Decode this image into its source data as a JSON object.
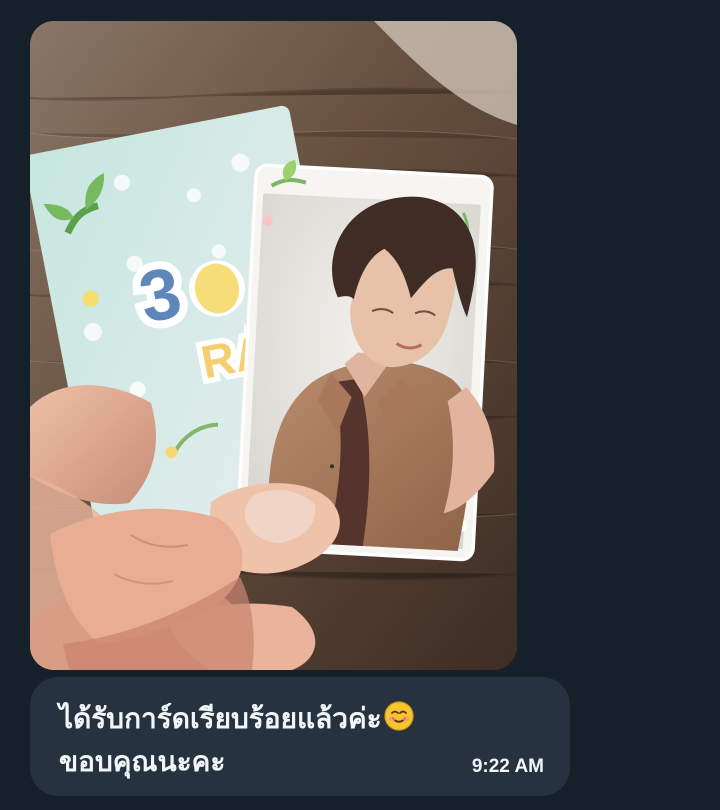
{
  "message": {
    "image": {
      "subject": "hand-holding-photocard-icon"
    },
    "text_line_1": "ได้รับการ์ดเรียบร้อยแล้วค่ะ",
    "emoji": "smiling-face-icon",
    "text_line_2": "ขอบคุณนะคะ",
    "time": "9:22 AM"
  },
  "theme": {
    "background": "#16202b",
    "bubble": "#26323f",
    "text": "#f3f6f8"
  }
}
